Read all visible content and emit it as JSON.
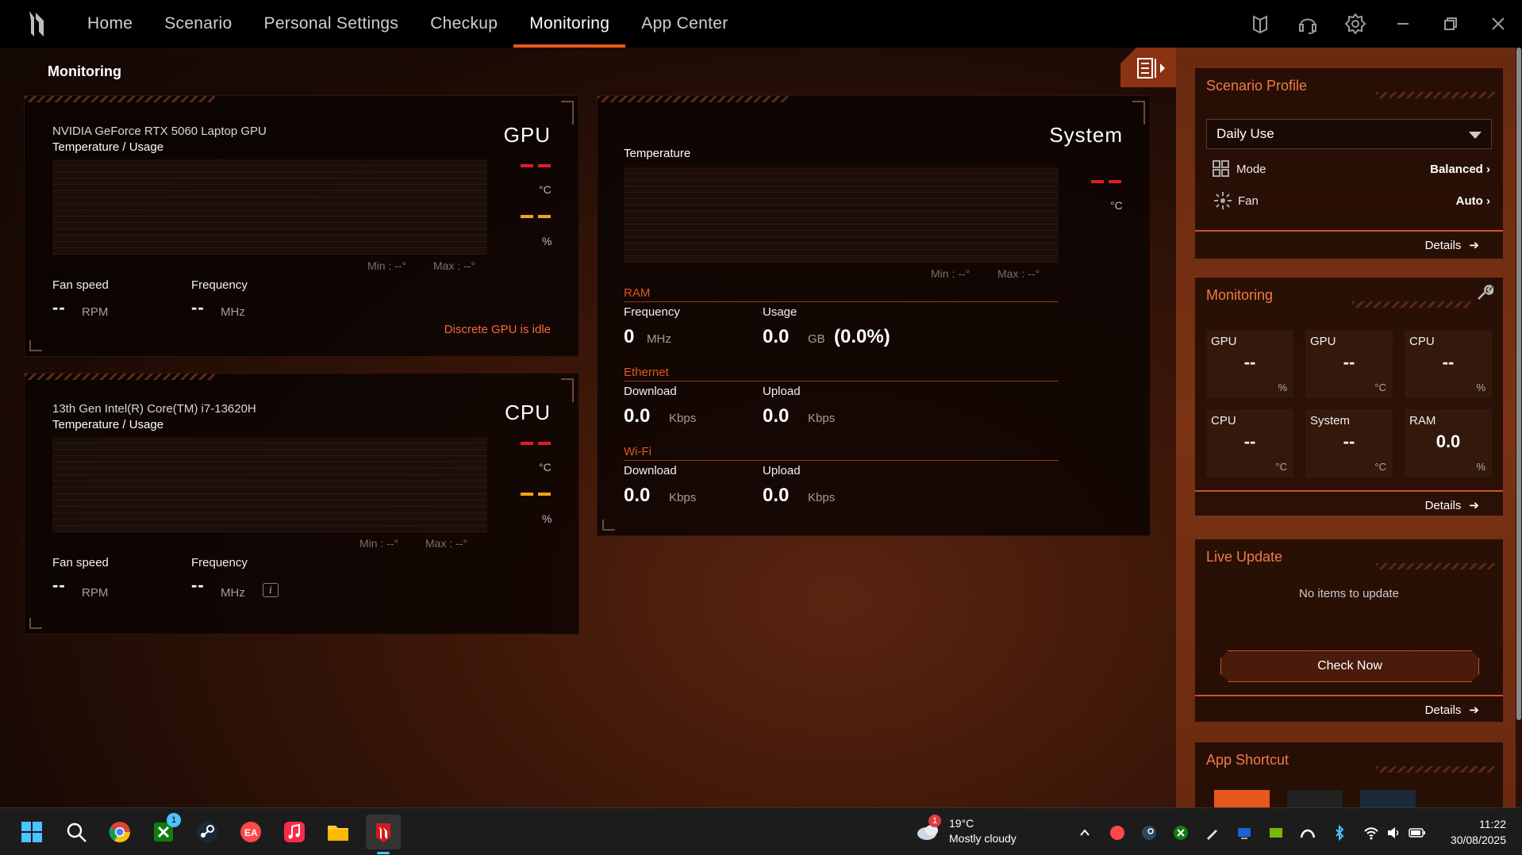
{
  "nav": {
    "items": [
      "Home",
      "Scenario",
      "Personal Settings",
      "Checkup",
      "Monitoring",
      "App Center"
    ]
  },
  "page_title": "Monitoring",
  "gpu": {
    "name": "NVIDIA GeForce RTX 5060 Laptop GPU",
    "subtitle": "Temperature / Usage",
    "label": "GPU",
    "temp_unit": "°C",
    "usage_unit": "%",
    "min": "Min : --°",
    "max": "Max : --°",
    "fan_label": "Fan speed",
    "fan_value": "--",
    "fan_unit": "RPM",
    "freq_label": "Frequency",
    "freq_value": "--",
    "freq_unit": "MHz",
    "status": "Discrete GPU is idle"
  },
  "cpu": {
    "name": "13th Gen Intel(R) Core(TM) i7-13620H",
    "subtitle": "Temperature / Usage",
    "label": "CPU",
    "temp_unit": "°C",
    "usage_unit": "%",
    "min": "Min : --°",
    "max": "Max : --°",
    "fan_label": "Fan speed",
    "fan_value": "--",
    "fan_unit": "RPM",
    "freq_label": "Frequency",
    "freq_value": "--",
    "freq_unit": "MHz"
  },
  "system": {
    "label": "System",
    "temp_label": "Temperature",
    "temp_unit": "°C",
    "min": "Min : --°",
    "max": "Max : --°",
    "ram": {
      "title": "RAM",
      "freq_label": "Frequency",
      "freq_value": "0",
      "freq_unit": "MHz",
      "usage_label": "Usage",
      "usage_value": "0.0",
      "usage_unit": "GB",
      "usage_pct": "(0.0%)"
    },
    "ethernet": {
      "title": "Ethernet",
      "down_label": "Download",
      "down_value": "0.0",
      "down_unit": "Kbps",
      "up_label": "Upload",
      "up_value": "0.0",
      "up_unit": "Kbps"
    },
    "wifi": {
      "title": "Wi-Fi",
      "down_label": "Download",
      "down_value": "0.0",
      "down_unit": "Kbps",
      "up_label": "Upload",
      "up_value": "0.0",
      "up_unit": "Kbps"
    }
  },
  "sidebar": {
    "scenario": {
      "title": "Scenario Profile",
      "selected": "Daily Use",
      "mode_label": "Mode",
      "mode_value": "Balanced",
      "fan_label": "Fan",
      "fan_value": "Auto",
      "details": "Details"
    },
    "monitoring": {
      "title": "Monitoring",
      "details": "Details",
      "tiles": [
        {
          "name": "GPU",
          "value": "--",
          "unit": "%"
        },
        {
          "name": "GPU",
          "value": "--",
          "unit": "°C"
        },
        {
          "name": "CPU",
          "value": "--",
          "unit": "%"
        },
        {
          "name": "CPU",
          "value": "--",
          "unit": "°C"
        },
        {
          "name": "System",
          "value": "--",
          "unit": "°C"
        },
        {
          "name": "RAM",
          "value": "0.0",
          "unit": "%"
        }
      ]
    },
    "live_update": {
      "title": "Live Update",
      "message": "No items to update",
      "button": "Check Now",
      "details": "Details"
    },
    "app_shortcut": {
      "title": "App Shortcut"
    }
  },
  "taskbar": {
    "weather_temp": "19°C",
    "weather_desc": "Mostly cloudy",
    "weather_badge": "1",
    "xbox_badge": "1",
    "time": "11:22",
    "date": "30/08/2025"
  },
  "colors": {
    "accent": "#e8571c",
    "red": "#e21b2b",
    "yellow": "#f0a21c"
  }
}
